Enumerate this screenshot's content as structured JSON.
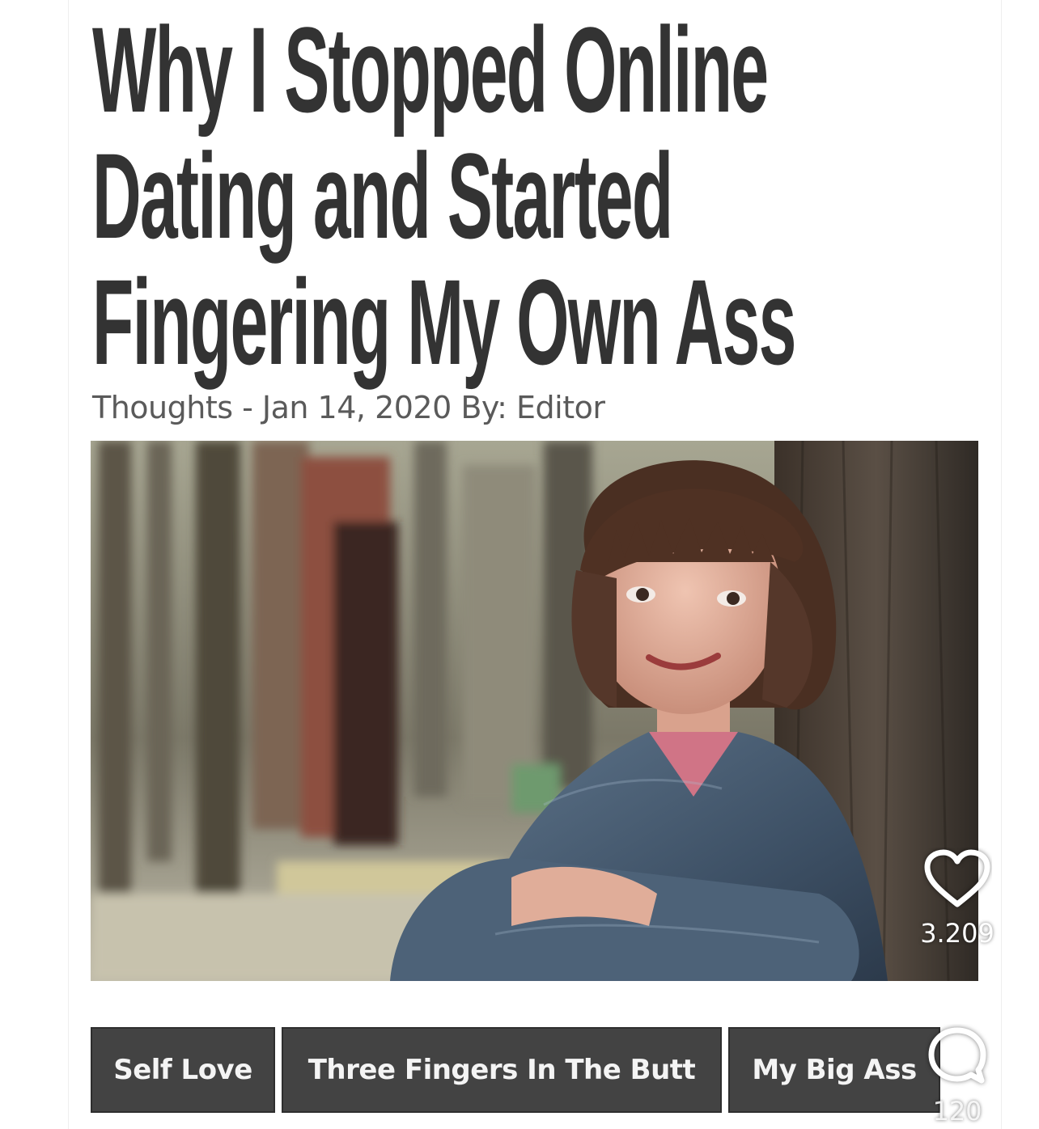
{
  "article": {
    "headline_lines": [
      "Why I Stopped Online",
      "Dating and Started",
      "Fingering My Own Ass"
    ],
    "meta": "Thoughts - Jan 14, 2020 By: Editor"
  },
  "tags": [
    "Self Love",
    "Three Fingers In The Butt",
    "My Big Ass"
  ],
  "overlay": {
    "like_icon": "heart-icon",
    "like_count": "3.209",
    "comment_icon": "comment-bubble-icon",
    "comment_count": "120"
  },
  "colors": {
    "headline": "#333333",
    "meta": "#5a5a5a",
    "tag_background": "#434343",
    "tag_text": "#f4f4f4"
  }
}
